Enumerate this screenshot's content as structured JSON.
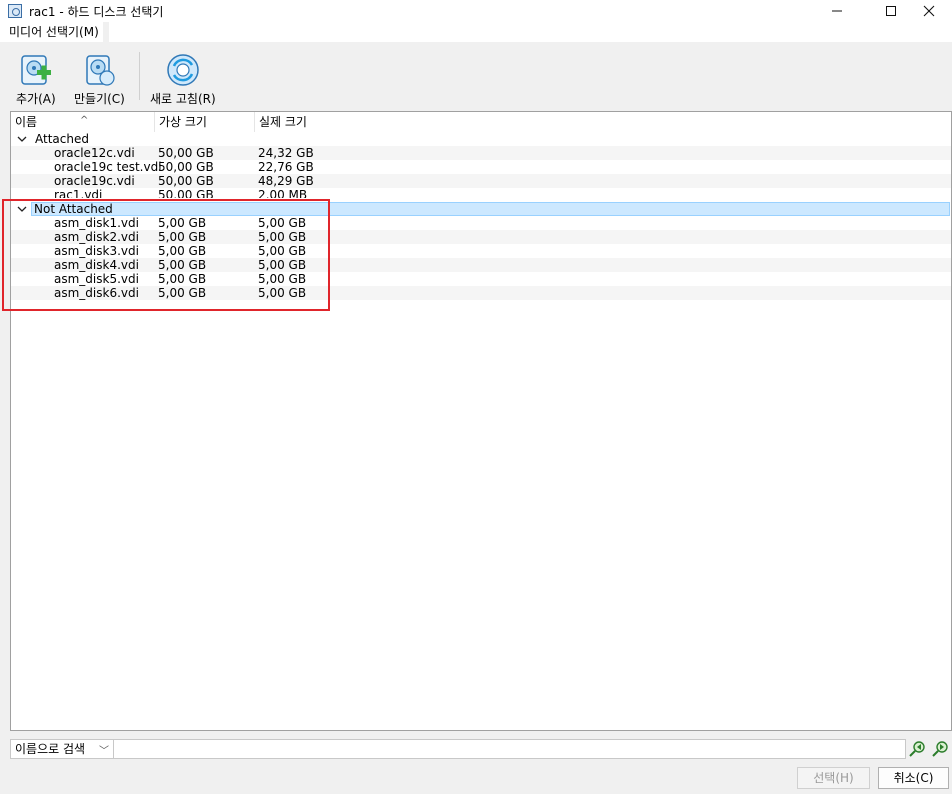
{
  "window": {
    "title": "rac1 - 하드 디스크 선택기"
  },
  "menu": {
    "media_selector": "미디어 선택기(M)"
  },
  "toolbar": {
    "add_label": "추가(A)",
    "create_label": "만들기(C)",
    "refresh_label": "새로 고침(R)"
  },
  "tree": {
    "columns": [
      "이름",
      "가상 크기",
      "실제 크기"
    ],
    "groups": [
      {
        "label": "Attached",
        "rows": [
          {
            "name": "oracle12c.vdi",
            "virtual": "50,00 GB",
            "actual": "24,32 GB"
          },
          {
            "name": "oracle19c test.vdi",
            "virtual": "50,00 GB",
            "actual": "22,76 GB"
          },
          {
            "name": "oracle19c.vdi",
            "virtual": "50,00 GB",
            "actual": "48,29 GB"
          },
          {
            "name": "rac1.vdi",
            "virtual": "50,00 GB",
            "actual": "2,00 MB"
          }
        ]
      },
      {
        "label": "Not Attached",
        "rows": [
          {
            "name": "asm_disk1.vdi",
            "virtual": "5,00 GB",
            "actual": "5,00 GB"
          },
          {
            "name": "asm_disk2.vdi",
            "virtual": "5,00 GB",
            "actual": "5,00 GB"
          },
          {
            "name": "asm_disk3.vdi",
            "virtual": "5,00 GB",
            "actual": "5,00 GB"
          },
          {
            "name": "asm_disk4.vdi",
            "virtual": "5,00 GB",
            "actual": "5,00 GB"
          },
          {
            "name": "asm_disk5.vdi",
            "virtual": "5,00 GB",
            "actual": "5,00 GB"
          },
          {
            "name": "asm_disk6.vdi",
            "virtual": "5,00 GB",
            "actual": "5,00 GB"
          }
        ]
      }
    ]
  },
  "search": {
    "mode": "이름으로 검색",
    "value": ""
  },
  "buttons": {
    "select": "선택(H)",
    "cancel": "취소(C)"
  },
  "colors": {
    "selection": "#cce8ff",
    "highlight_box": "#e0252b"
  }
}
